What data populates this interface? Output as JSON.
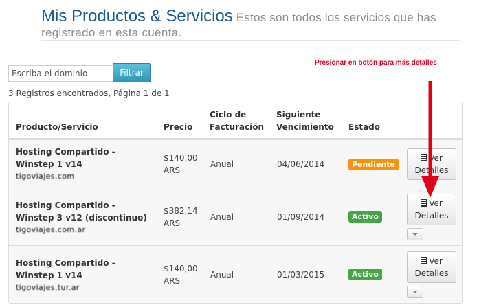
{
  "header": {
    "title": "Mis Productos & Servicios",
    "subtitle_line1": "Estos son todos los servicios que has",
    "subtitle_line2": "registrado en esta cuenta."
  },
  "filter": {
    "placeholder": "Escriba el dominio",
    "button_label": "Filtrar"
  },
  "annotation": "Presionar en botón para más detalles",
  "records_text": "3 Registros encontrados, Página 1 de 1",
  "table": {
    "columns": [
      "Producto/Servicio",
      "Precio",
      "Ciclo de Facturación",
      "Siguiente Vencimiento",
      "Estado"
    ],
    "column_lines": {
      "product": "Producto/Servicio",
      "price": "Precio",
      "cycle_1": "Ciclo de",
      "cycle_2": "Facturación",
      "next_1": "Siguiente",
      "next_2": "Vencimiento",
      "status": "Estado"
    },
    "rows": [
      {
        "product_1": "Hosting Compartido -",
        "product_2": "Winstep 1 v14",
        "domain": "tigoviajes.com",
        "price_1": "$140,00",
        "price_2": "ARS",
        "cycle": "Anual",
        "next_due": "04/06/2014",
        "status": "Pendiente",
        "btn_1": "Ver",
        "btn_2": "Detalles"
      },
      {
        "product_1": "Hosting Compartido -",
        "product_2": "Winstep 3 v12 (discontinuo)",
        "domain": "tigoviajes.com.ar",
        "price_1": "$382,14",
        "price_2": "ARS",
        "cycle": "Anual",
        "next_due": "01/09/2014",
        "status": "Activo",
        "btn_1": "Ver",
        "btn_2": "Detalles"
      },
      {
        "product_1": "Hosting Compartido -",
        "product_2": "Winstep 1 v14",
        "domain": "tigoviajes.tur.ar",
        "price_1": "$140,00",
        "price_2": "ARS",
        "cycle": "Anual",
        "next_due": "01/03/2015",
        "status": "Activo",
        "btn_1": "Ver",
        "btn_2": "Detalles"
      }
    ]
  },
  "colors": {
    "title": "#1f5a8f",
    "pending": "#f89406",
    "active": "#46a546",
    "annotation": "#e0001a"
  }
}
